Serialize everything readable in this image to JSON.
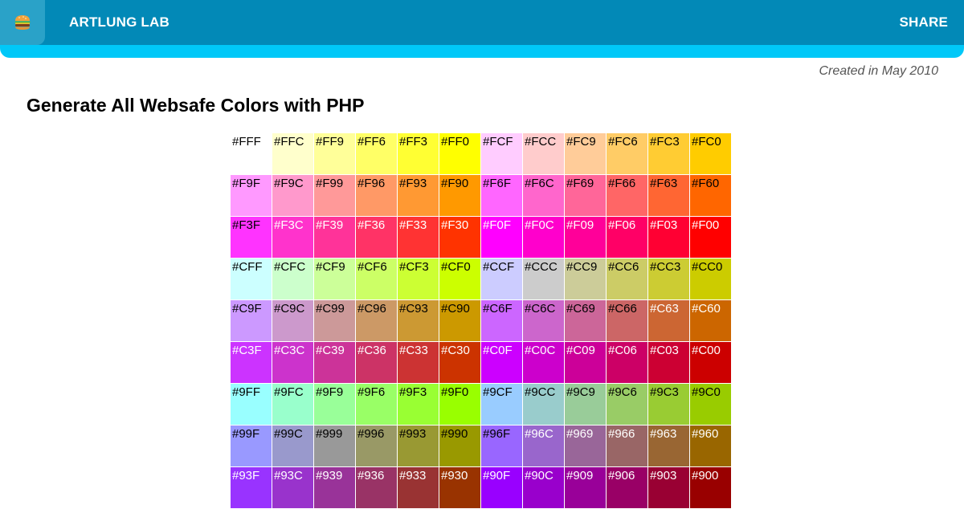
{
  "header": {
    "menu_icon": "burger-icon",
    "brand": "ARTLUNG LAB",
    "share_label": "SHARE",
    "colors": {
      "bar": "#0289b7",
      "accent": "#00c8f8",
      "menu": "#2aa2c8"
    }
  },
  "meta": {
    "created": "Created in May 2010"
  },
  "page": {
    "title": "Generate All Websafe Colors with PHP"
  },
  "grid": {
    "rows": [
      [
        "#FFF",
        "#FFC",
        "#FF9",
        "#FF6",
        "#FF3",
        "#FF0",
        "#FCF",
        "#FCC",
        "#FC9",
        "#FC6",
        "#FC3",
        "#FC0"
      ],
      [
        "#F9F",
        "#F9C",
        "#F99",
        "#F96",
        "#F93",
        "#F90",
        "#F6F",
        "#F6C",
        "#F69",
        "#F66",
        "#F63",
        "#F60"
      ],
      [
        "#F3F",
        "#F3C",
        "#F39",
        "#F36",
        "#F33",
        "#F30",
        "#F0F",
        "#F0C",
        "#F09",
        "#F06",
        "#F03",
        "#F00"
      ],
      [
        "#CFF",
        "#CFC",
        "#CF9",
        "#CF6",
        "#CF3",
        "#CF0",
        "#CCF",
        "#CCC",
        "#CC9",
        "#CC6",
        "#CC3",
        "#CC0"
      ],
      [
        "#C9F",
        "#C9C",
        "#C99",
        "#C96",
        "#C93",
        "#C90",
        "#C6F",
        "#C6C",
        "#C69",
        "#C66",
        "#C63",
        "#C60"
      ],
      [
        "#C3F",
        "#C3C",
        "#C39",
        "#C36",
        "#C33",
        "#C30",
        "#C0F",
        "#C0C",
        "#C09",
        "#C06",
        "#C03",
        "#C00"
      ],
      [
        "#9FF",
        "#9FC",
        "#9F9",
        "#9F6",
        "#9F3",
        "#9F0",
        "#9CF",
        "#9CC",
        "#9C9",
        "#9C6",
        "#9C3",
        "#9C0"
      ],
      [
        "#99F",
        "#99C",
        "#999",
        "#996",
        "#993",
        "#990",
        "#96F",
        "#96C",
        "#969",
        "#966",
        "#963",
        "#960"
      ],
      [
        "#93F",
        "#93C",
        "#939",
        "#936",
        "#933",
        "#930",
        "#90F",
        "#90C",
        "#909",
        "#906",
        "#903",
        "#900"
      ]
    ]
  }
}
